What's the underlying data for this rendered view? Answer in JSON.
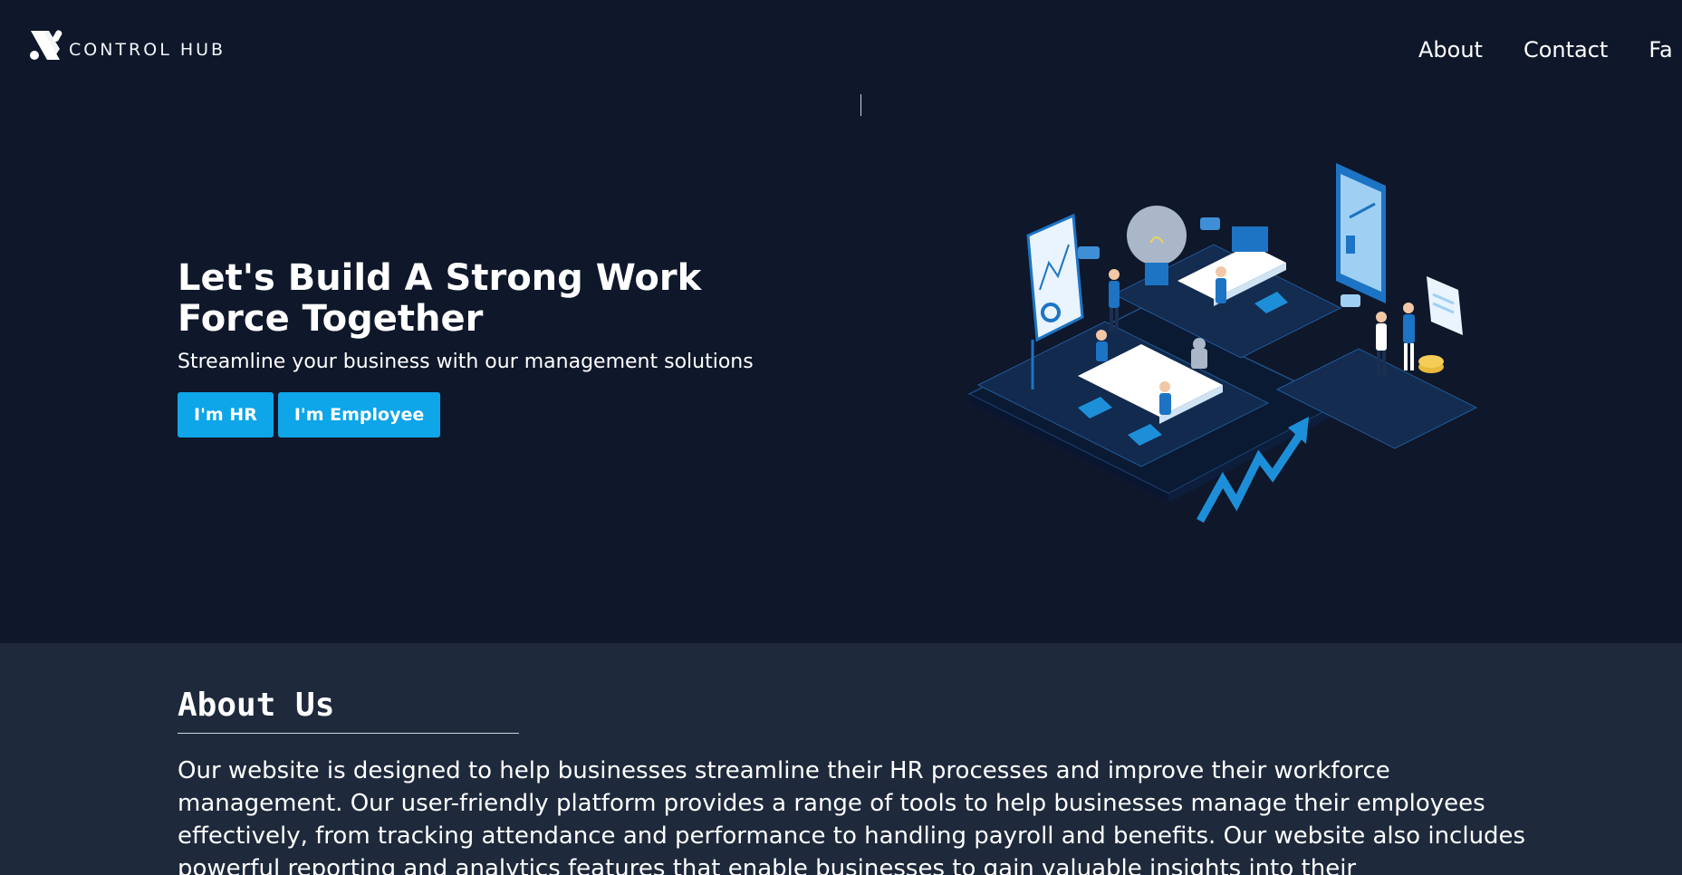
{
  "navbar": {
    "brand_name": "CONTROL HUB",
    "links": [
      "About",
      "Contact",
      "Fa"
    ]
  },
  "hero": {
    "title": "Let's Build A Strong Work Force Together",
    "subtitle": "Streamline your business with our management solutions",
    "hr_button": "I'm HR",
    "employee_button": "I'm Employee"
  },
  "about": {
    "title": "About Us",
    "text": "Our website is designed to help businesses streamline their HR processes and improve their workforce management. Our user-friendly platform provides a range of tools to help businesses manage their employees effectively, from tracking attendance and performance to handling payroll and benefits. Our website also includes powerful reporting and analytics features that enable businesses to gain valuable insights into their"
  },
  "colors": {
    "background": "#0f172a",
    "about_background": "#1e293b",
    "accent": "#0ea5e9"
  },
  "icons": {
    "brand_logo": "stylized-x-logo",
    "hero_illustration": "isometric-office-teamwork"
  }
}
